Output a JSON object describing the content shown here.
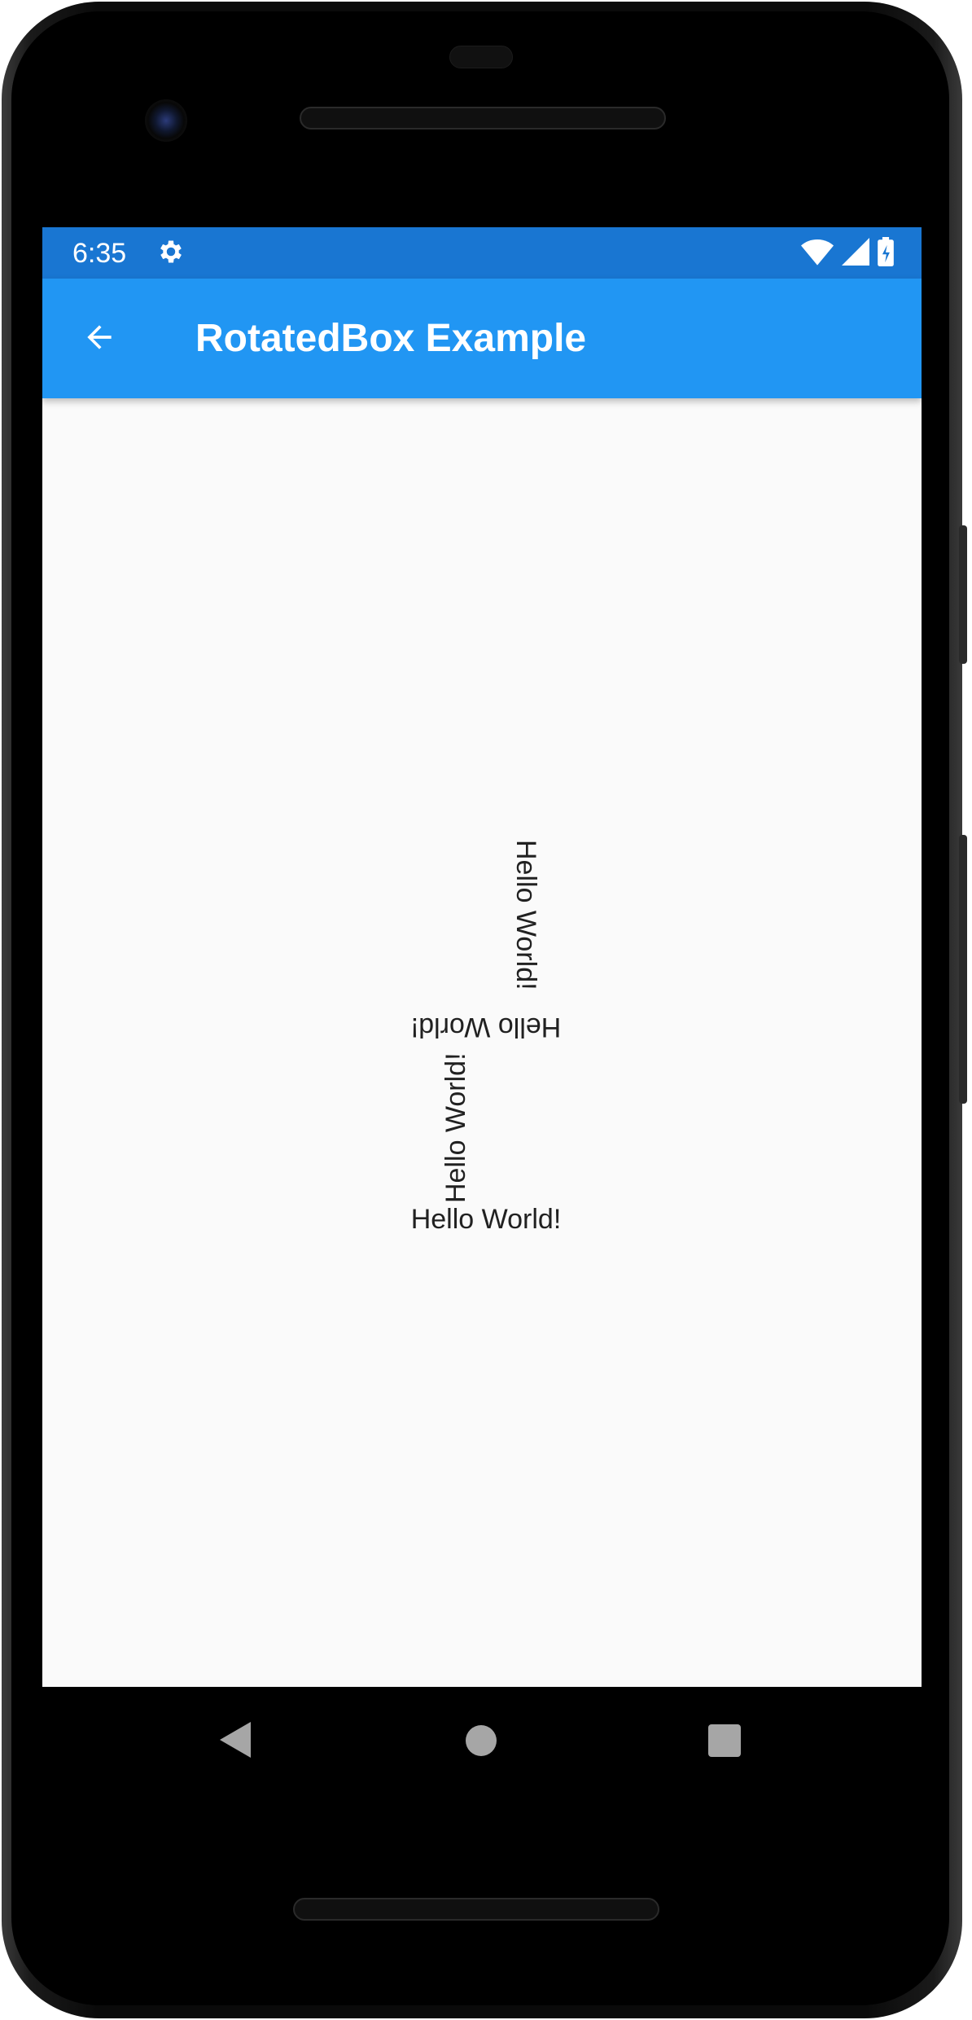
{
  "status_bar": {
    "time": "6:35",
    "icons": [
      "gear-icon",
      "wifi-icon",
      "signal-icon",
      "battery-charging-icon"
    ],
    "color": "#1976d2"
  },
  "app_bar": {
    "title": "RotatedBox Example",
    "back_icon": "arrow-back-icon",
    "color": "#2196f3"
  },
  "content": {
    "texts": [
      {
        "text": "Hello World!",
        "rotation": "quarter-turn-1"
      },
      {
        "text": "Hello World!",
        "rotation": "quarter-turn-2"
      },
      {
        "text": "Hello World!",
        "rotation": "quarter-turn-3"
      },
      {
        "text": "Hello World!",
        "rotation": "none"
      }
    ],
    "background": "#fafafa"
  },
  "nav_bar": {
    "buttons": [
      "nav-back-icon",
      "nav-home-icon",
      "nav-recents-icon"
    ]
  }
}
